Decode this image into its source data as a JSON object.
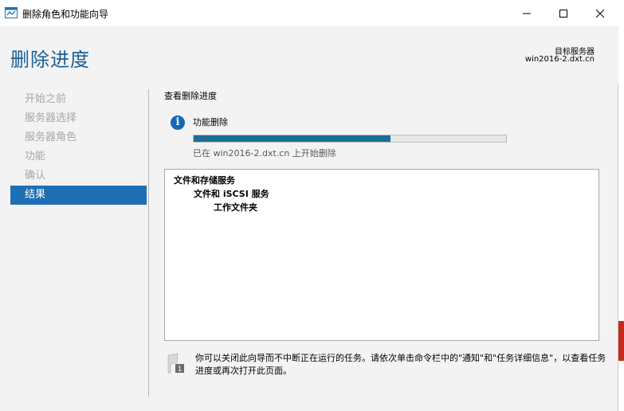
{
  "window": {
    "title": "删除角色和功能向导",
    "minimize_icon": "minimize-icon",
    "maximize_icon": "maximize-icon",
    "close_icon": "close-icon"
  },
  "header": {
    "page_title": "删除进度",
    "target_label": "目标服务器",
    "target_server": "win2016-2.dxt.cn"
  },
  "sidebar": {
    "items": [
      {
        "label": "开始之前",
        "active": false
      },
      {
        "label": "服务器选择",
        "active": false
      },
      {
        "label": "服务器角色",
        "active": false
      },
      {
        "label": "功能",
        "active": false
      },
      {
        "label": "确认",
        "active": false
      },
      {
        "label": "结果",
        "active": true
      }
    ]
  },
  "main": {
    "section_title": "查看删除进度",
    "feature_label": "功能删除",
    "progress_fraction": 0.63,
    "progress_status": "已在 win2016-2.dxt.cn 上开始删除",
    "results": {
      "level1": "文件和存储服务",
      "level2": "文件和 iSCSI 服务",
      "level3": "工作文件夹"
    },
    "note": "你可以关闭此向导而不中断正在运行的任务。请依次单击命令栏中的\"通知\"和\"任务详细信息\"，以查看任务进度或再次打开此页面。"
  },
  "colors": {
    "accent": "#1f6fb4",
    "title": "#1a5f97",
    "progress": "#1a6f95"
  }
}
